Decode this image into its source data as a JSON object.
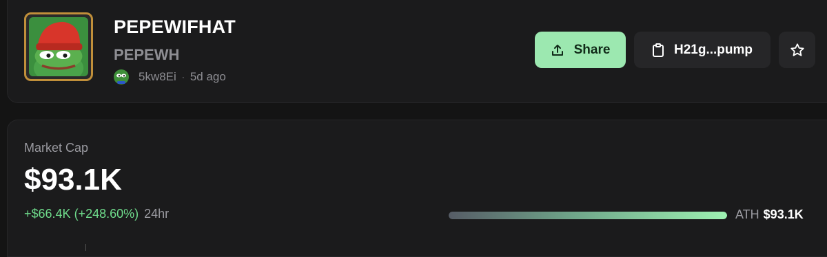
{
  "token": {
    "name": "PEPEWIFHAT",
    "symbol": "PEPEWH",
    "creator": "5kw8Ei",
    "age": "5d ago",
    "dot": "·"
  },
  "actions": {
    "share_label": "Share",
    "contract_label": "H21g...pump"
  },
  "icons": {
    "share": "share-upload-icon",
    "contract": "clipboard-icon",
    "favorite": "star-icon"
  },
  "stats": {
    "market_cap_label": "Market Cap",
    "market_cap_value": "$93.1K",
    "change": "+$66.4K (+248.60%)",
    "period": "24hr",
    "ath_label": "ATH",
    "ath_value": "$93.1K",
    "ath_progress_pct": 100
  },
  "colors": {
    "accent_green": "#9ce8b0",
    "positive": "#6fdc8c",
    "avatar_border": "#c08f3a"
  }
}
